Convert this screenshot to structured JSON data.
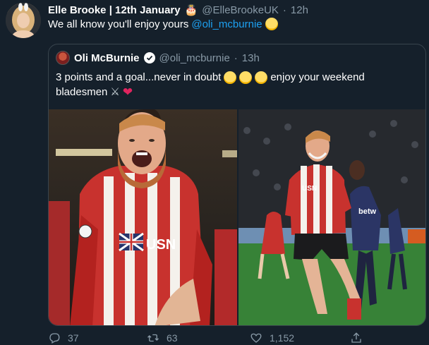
{
  "author": {
    "name": "Elle Brooke | 12th January",
    "handle": "@ElleBrookeUK",
    "separator": "·",
    "time": "12h"
  },
  "tweet": {
    "text_before": "We all know you'll enjoy yours",
    "mention": "@oli_mcburnie"
  },
  "quoted": {
    "name": "Oli McBurnie",
    "handle": "@oli_mcburnie",
    "separator": "·",
    "time": "13h",
    "line1": "3 points and a goal...never in doubt",
    "line1_suffix": "enjoy your weekend",
    "line2": "bladesmen"
  },
  "actions": {
    "replies": "37",
    "retweets": "63",
    "likes": "1,152"
  },
  "colors": {
    "background": "#15202b",
    "mention": "#1da1f2",
    "muted": "#8899a6",
    "heart": "#e0245e",
    "border": "#38444d"
  }
}
